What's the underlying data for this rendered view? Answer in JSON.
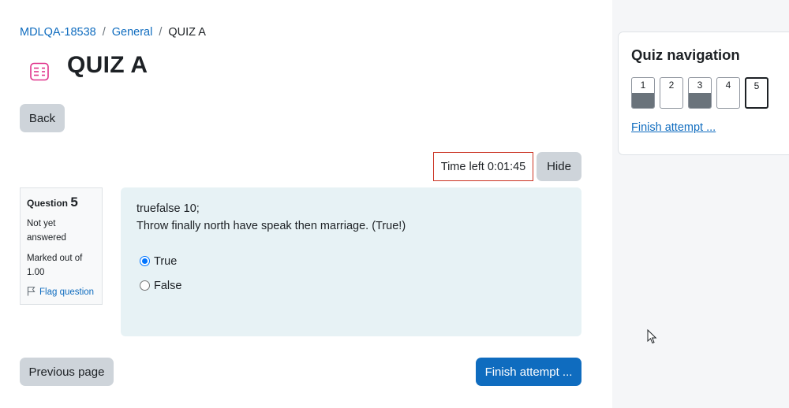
{
  "breadcrumb": {
    "course": "MDLQA-18538",
    "section": "General",
    "current": "QUIZ A",
    "separator": "/"
  },
  "page": {
    "title": "QUIZ A",
    "icon": "quiz-icon"
  },
  "buttons": {
    "back": "Back",
    "hide": "Hide",
    "previous_page": "Previous page",
    "finish_attempt": "Finish attempt ..."
  },
  "timer": {
    "text": "Time left 0:01:45"
  },
  "question": {
    "label": "Question",
    "number": "5",
    "state": "Not yet answered",
    "grade": "Marked out of 1.00",
    "flag_label": "Flag question",
    "name": "truefalse 10;",
    "text": "Throw finally north have speak then marriage. (True!)",
    "options": [
      {
        "label": "True",
        "checked": true
      },
      {
        "label": "False",
        "checked": false
      }
    ]
  },
  "quiz_navigation": {
    "title": "Quiz navigation",
    "items": [
      {
        "label": "1",
        "answered": true,
        "current": false
      },
      {
        "label": "2",
        "answered": false,
        "current": false
      },
      {
        "label": "3",
        "answered": true,
        "current": false
      },
      {
        "label": "4",
        "answered": false,
        "current": false
      },
      {
        "label": "5",
        "answered": false,
        "current": true
      }
    ],
    "finish_link": "Finish attempt ..."
  },
  "colors": {
    "primary": "#0f6cbf",
    "secondary_button": "#ced4da",
    "question_bg": "#e7f2f5",
    "timer_border": "#ca3120",
    "answered_fill": "#6a737b",
    "drawer_bg": "#f5f6f8"
  }
}
